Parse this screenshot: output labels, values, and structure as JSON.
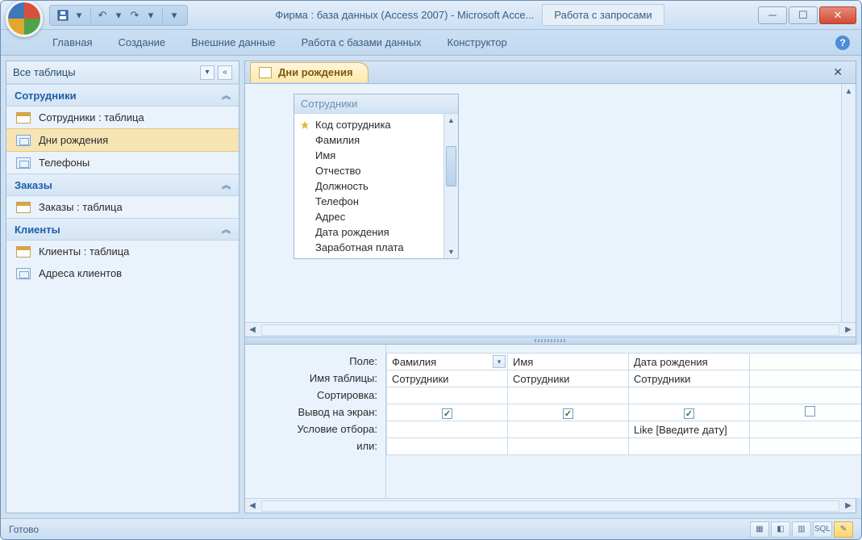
{
  "window": {
    "app_title": "Фирма : база данных (Access 2007)  -  Microsoft Acce...",
    "context_tab": "Работа с запросами"
  },
  "ribbon": {
    "tabs": [
      "Главная",
      "Создание",
      "Внешние данные",
      "Работа с базами данных",
      "Конструктор"
    ]
  },
  "nav": {
    "title": "Все таблицы",
    "groups": [
      {
        "name": "Сотрудники",
        "items": [
          {
            "label": "Сотрудники : таблица",
            "type": "table"
          },
          {
            "label": "Дни рождения",
            "type": "query",
            "selected": true
          },
          {
            "label": "Телефоны",
            "type": "query"
          }
        ]
      },
      {
        "name": "Заказы",
        "items": [
          {
            "label": "Заказы : таблица",
            "type": "table"
          }
        ]
      },
      {
        "name": "Клиенты",
        "items": [
          {
            "label": "Клиенты : таблица",
            "type": "table"
          },
          {
            "label": "Адреса клиентов",
            "type": "query"
          }
        ]
      }
    ]
  },
  "doc": {
    "tab_label": "Дни рождения",
    "table_header": "Сотрудники",
    "fields": [
      "Код сотрудника",
      "Фамилия",
      "Имя",
      "Отчество",
      "Должность",
      "Телефон",
      "Адрес",
      "Дата рождения",
      "Заработная плата"
    ]
  },
  "grid": {
    "row_labels": {
      "field": "Поле:",
      "table": "Имя таблицы:",
      "sort": "Сортировка:",
      "show": "Вывод на экран:",
      "criteria": "Условие отбора:",
      "or": "или:"
    },
    "columns": [
      {
        "field": "Фамилия",
        "table": "Сотрудники",
        "show": true,
        "criteria": ""
      },
      {
        "field": "Имя",
        "table": "Сотрудники",
        "show": true,
        "criteria": ""
      },
      {
        "field": "Дата рождения",
        "table": "Сотрудники",
        "show": true,
        "criteria": "Like [Введите дату]"
      }
    ]
  },
  "status": {
    "text": "Готово",
    "sql_label": "SQL"
  }
}
